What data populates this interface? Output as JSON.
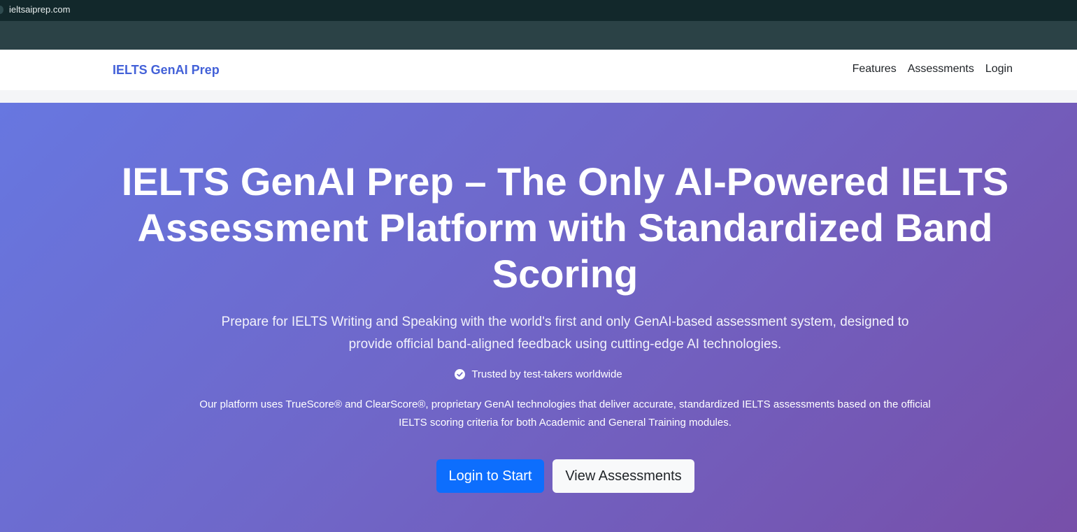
{
  "browser": {
    "url": "ieltsaiprep.com"
  },
  "navbar": {
    "brand": "IELTS GenAI Prep",
    "links": [
      "Features",
      "Assessments",
      "Login"
    ]
  },
  "hero": {
    "title": "IELTS GenAI Prep – The Only AI-Powered IELTS Assessment Platform with Standardized Band Scoring",
    "lead": "Prepare for IELTS Writing and Speaking with the world's first and only GenAI-based assessment system, designed to provide official band-aligned feedback using cutting-edge AI technologies.",
    "trusted": "Trusted by test-takers worldwide",
    "description": "Our platform uses TrueScore® and ClearScore®, proprietary GenAI technologies that deliver accurate, standardized IELTS assessments based on the official IELTS scoring criteria for both Academic and General Training modules.",
    "primary_button": "Login to Start",
    "secondary_button": "View Assessments"
  },
  "colors": {
    "brand": "#4361d8",
    "primary_button": "#0d6efd",
    "hero_gradient_start": "#6777e0",
    "hero_gradient_end": "#774fa9"
  },
  "icons": {
    "trusted": "check-circle-icon"
  }
}
